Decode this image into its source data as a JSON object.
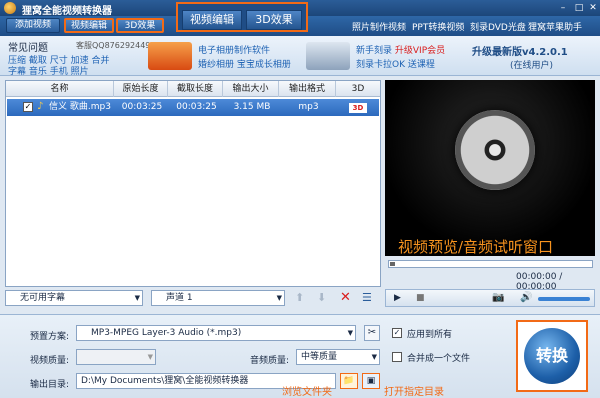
{
  "app": {
    "title": "狸窝全能视频转换器"
  },
  "toolbar": {
    "add_video": "添加视频",
    "video_edit": "视频编辑",
    "effect_3d": "3D效果",
    "big_tab_edit": "视频编辑",
    "big_tab_3d": "3D效果",
    "links": [
      "照片制作视频",
      "PPT转换视频",
      "刻录DVD光盘",
      "狸窝苹果助手"
    ]
  },
  "band": {
    "faq": "常见问题",
    "qq": "客服QQ876292449",
    "tags_line1": "压缩 截取 尺寸 加速 合并",
    "tags_line2": "字幕 音乐 手机 照片",
    "ad1_title": "电子相册制作软件",
    "ad1_sub": "婚纱相册 宝宝成长相册",
    "ad2_title_pre": "新手刻录",
    "ad2_title_hl": "升级VIP会员",
    "ad2_sub": "刻录卡拉OK 送课程",
    "upgrade": "升级最新版v4.2.0.1",
    "online": "(在线用户)"
  },
  "list": {
    "headers": [
      "名称",
      "原始长度",
      "截取长度",
      "输出大小",
      "输出格式",
      "3D"
    ],
    "rows": [
      {
        "name": "信义 歌曲.mp3",
        "orig": "00:03:25",
        "cut": "00:03:25",
        "size": "3.15 MB",
        "format": "mp3",
        "d3": "3D"
      }
    ]
  },
  "listbar": {
    "subtitle": "无可用字幕",
    "audio": "声道 1"
  },
  "preview": {
    "overlay": "视频预览/音频试听窗口",
    "time": "00:00:00 / 00:00:00"
  },
  "settings": {
    "preset_label": "预置方案:",
    "preset_value": "MP3-MPEG Layer-3 Audio (*.mp3)",
    "apply_all": "应用到所有",
    "video_quality_label": "视频质量:",
    "video_quality_value": "",
    "audio_quality_label": "音频质量:",
    "audio_quality_value": "中等质量",
    "merge": "合并成一个文件",
    "output_label": "输出目录:",
    "output_value": "D:\\My Documents\\狸窝\\全能视频转换器",
    "convert": "转换",
    "annot_browse": "浏览文件夹",
    "annot_open": "打开指定目录"
  },
  "colors": {
    "accent": "#f26a16",
    "highlight_row": "#2c69bd",
    "preview_text": "#f7931e"
  }
}
